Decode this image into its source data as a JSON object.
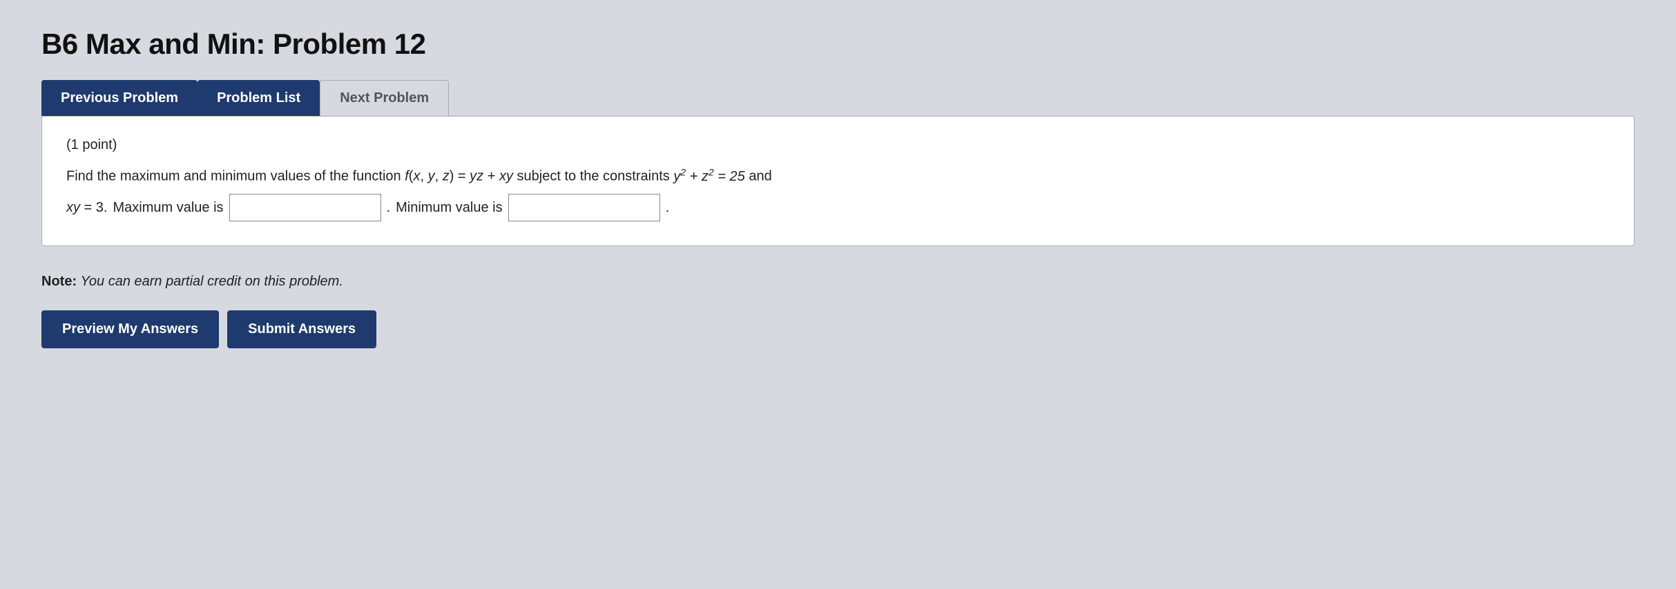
{
  "page": {
    "title": "B6 Max and Min: Problem 12",
    "nav": {
      "tabs": [
        {
          "label": "Previous Problem",
          "state": "active"
        },
        {
          "label": "Problem List",
          "state": "active"
        },
        {
          "label": "Next Problem",
          "state": "inactive"
        }
      ]
    },
    "problem": {
      "points": "(1 point)",
      "text_before": "Find the maximum and minimum values of the function",
      "function_expr": "f(x, y, z) = yz + xy",
      "text_middle": "subject to the constraints",
      "constraint1": "y² + z² = 25",
      "text_and": "and",
      "constraint2": "xy = 3.",
      "max_label": "Maximum value is",
      "min_label": "Minimum value is",
      "max_value": "",
      "min_value": ""
    },
    "note": {
      "label": "Note:",
      "text": "You can earn partial credit on this problem."
    },
    "buttons": {
      "preview": "Preview My Answers",
      "submit": "Submit Answers"
    }
  }
}
